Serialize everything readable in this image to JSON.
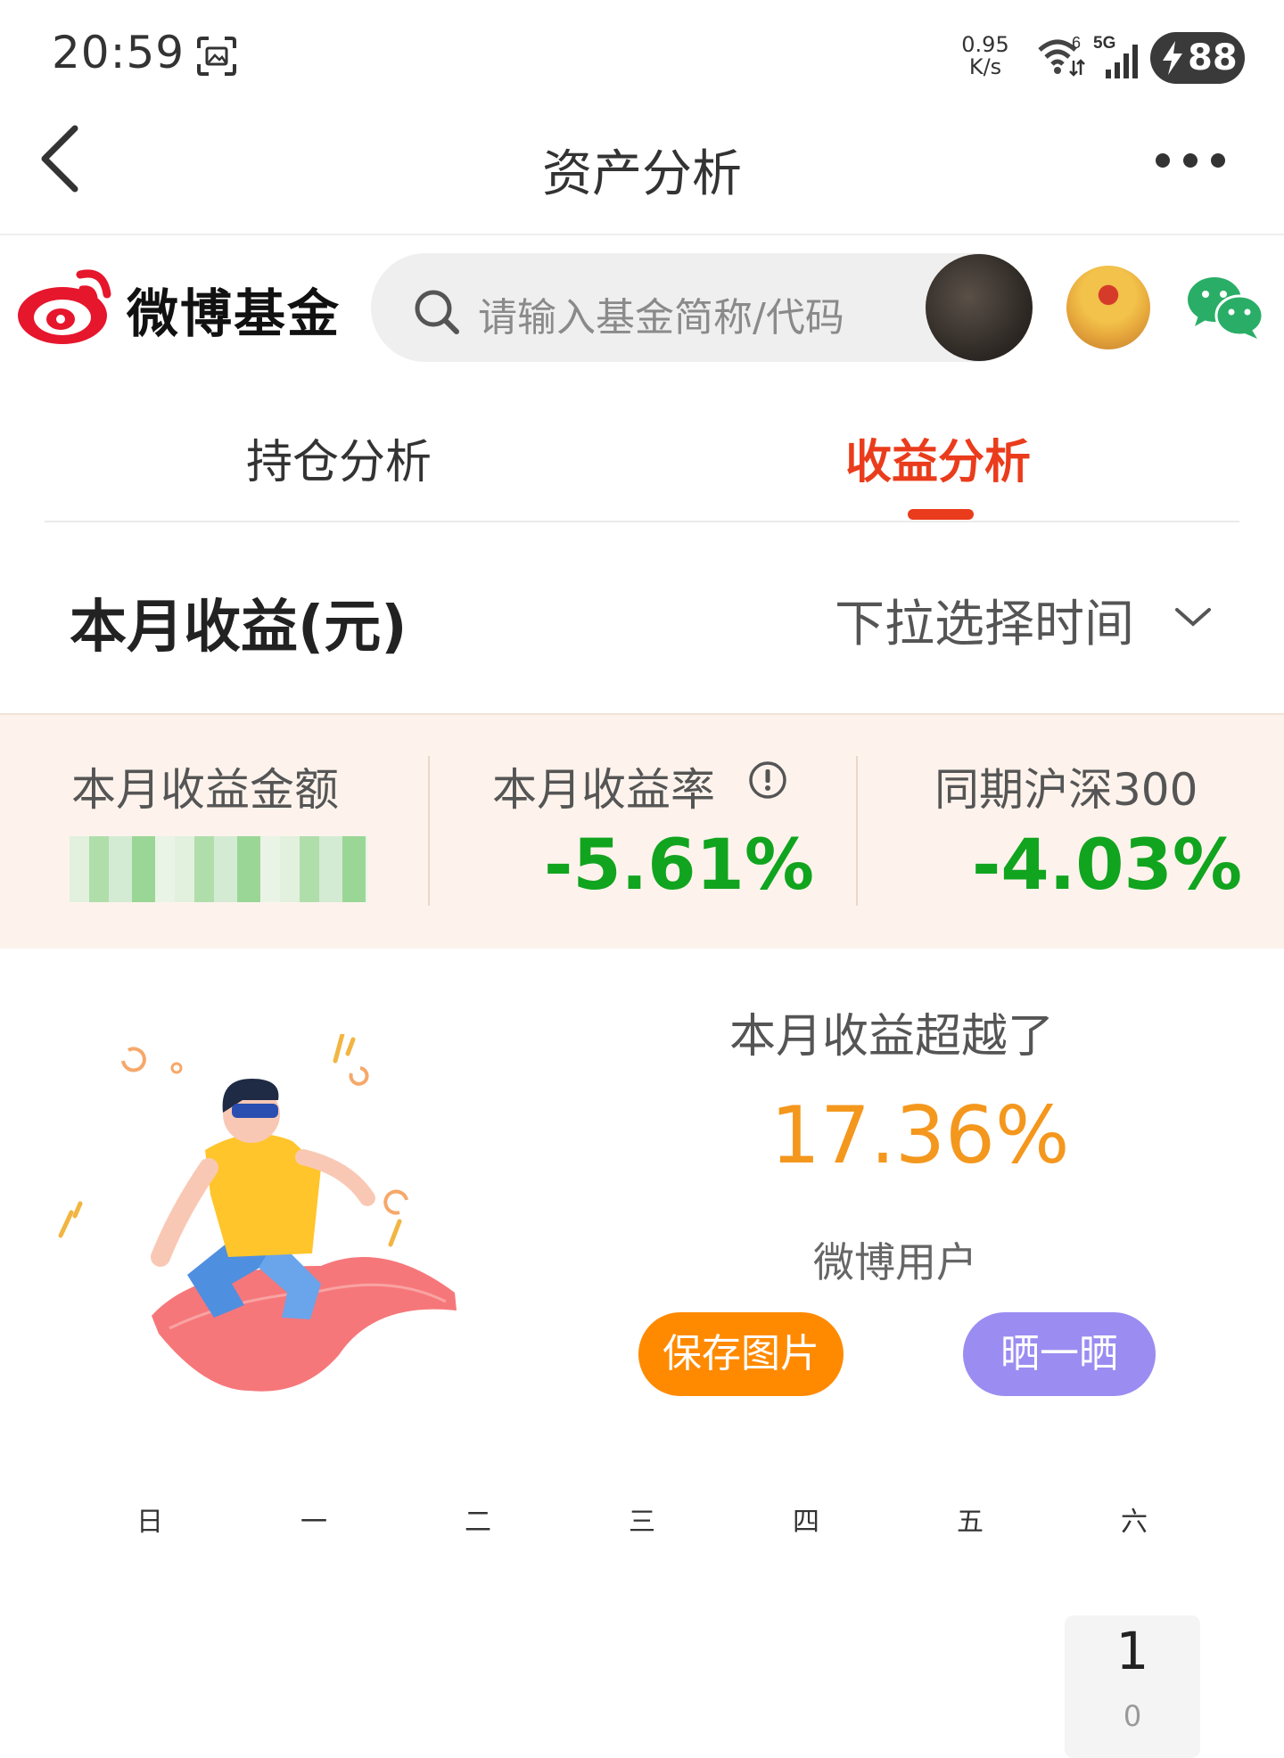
{
  "status_bar": {
    "time": "20:59",
    "net_speed_value": "0.95",
    "net_speed_unit": "K/s",
    "wifi_badge": "6",
    "signal_badge": "5G",
    "battery": "88"
  },
  "nav": {
    "title": "资产分析"
  },
  "brand": {
    "name": "微博基金"
  },
  "search": {
    "placeholder": "请输入基金简称/代码"
  },
  "tabs": [
    {
      "label": "持仓分析",
      "active": false
    },
    {
      "label": "收益分析",
      "active": true
    }
  ],
  "section": {
    "title": "本月收益(元)",
    "time_picker": "下拉选择时间"
  },
  "summary": {
    "amount_label": "本月收益金额",
    "rate_label": "本月收益率",
    "rate_value": "-5.61%",
    "csi_label": "同期沪深300",
    "csi_value": "-4.03%"
  },
  "beat": {
    "label": "本月收益超越了",
    "value": "17.36%",
    "group": "微博用户"
  },
  "actions": {
    "save": "保存图片",
    "share": "晒一晒"
  },
  "calendar": {
    "weekdays": [
      "日",
      "一",
      "二",
      "三",
      "四",
      "五",
      "六"
    ],
    "days": [
      {
        "day": "1",
        "value": "0"
      }
    ]
  },
  "colors": {
    "accent_red": "#ea3c1c",
    "loss_green": "#11a41f",
    "beat_orange": "#f4971d",
    "save_button": "#ff8a00",
    "share_button": "#9b8cf2",
    "summary_bg": "#fdf3ec"
  },
  "icons": [
    "screenshot-icon",
    "wifi-icon",
    "signal-icon",
    "back-icon",
    "more-icon",
    "weibo-logo",
    "search-icon",
    "wechat-icon",
    "chevron-down-icon",
    "info-icon"
  ]
}
